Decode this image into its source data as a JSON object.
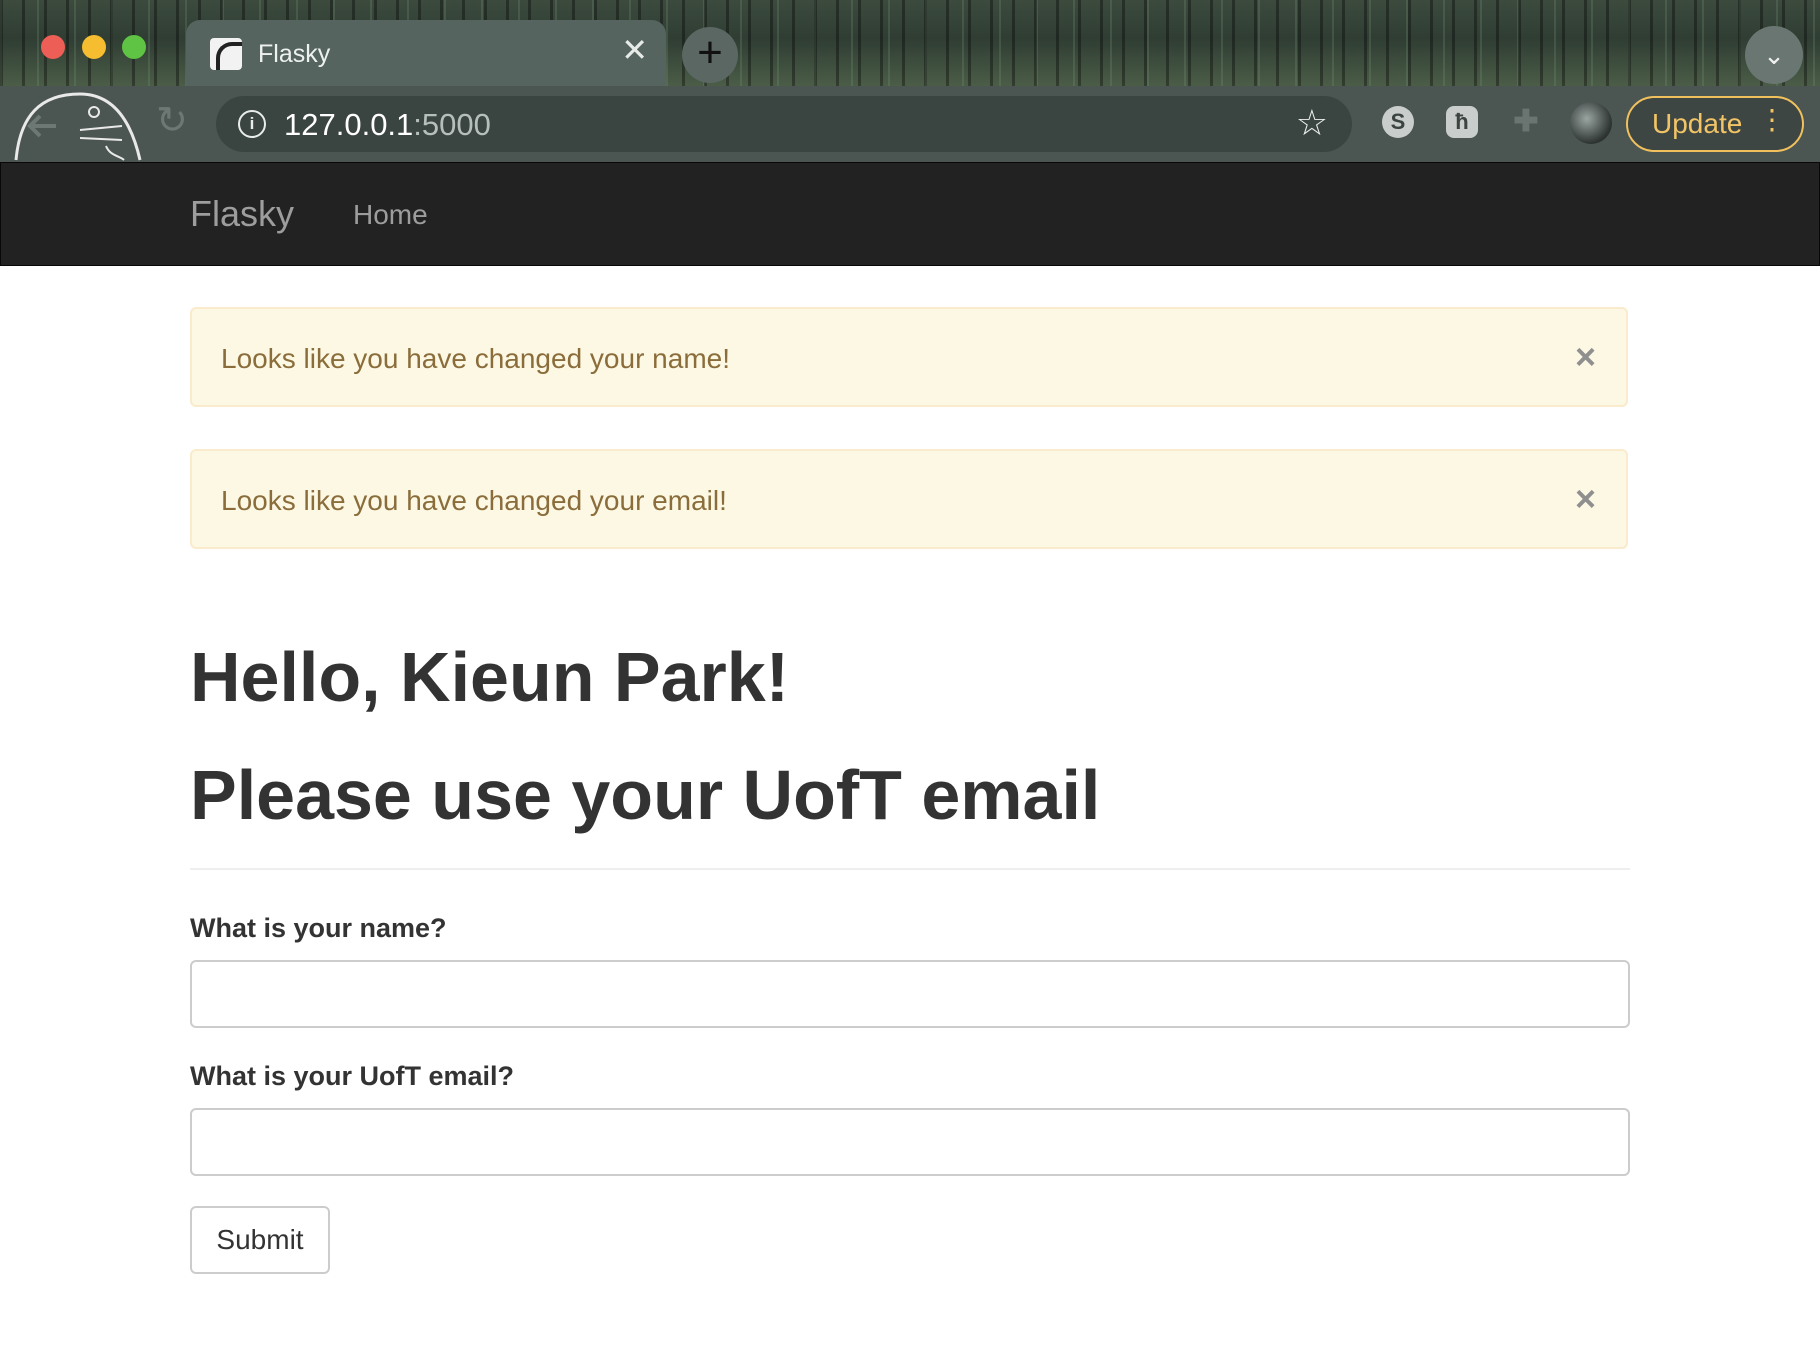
{
  "browser": {
    "tab_title": "Flasky",
    "tab_close_glyph": "✕",
    "new_tab_glyph": "+",
    "tab_search_glyph": "⌄",
    "url_host": "127.0.0.1",
    "url_port": ":5000",
    "update_label": "Update",
    "menu_glyph": "⋮",
    "extensions": [
      {
        "name": "s-extension-icon",
        "glyph": "S"
      },
      {
        "name": "h-extension-icon",
        "glyph": "ћ"
      },
      {
        "name": "puzzle-icon",
        "glyph": "✚"
      }
    ],
    "colors": {
      "accent": "#f3c466"
    }
  },
  "navbar": {
    "brand": "Flasky",
    "home": "Home"
  },
  "alerts": [
    {
      "text": "Looks like you have changed your name!",
      "close": "×"
    },
    {
      "text": "Looks like you have changed your email!",
      "close": "×"
    }
  ],
  "main": {
    "greeting": "Hello, Kieun Park!",
    "subtitle": "Please use your UofT email"
  },
  "form": {
    "name_label": "What is your name?",
    "name_value": "",
    "email_label": "What is your UofT email?",
    "email_value": "",
    "submit_label": "Submit"
  }
}
